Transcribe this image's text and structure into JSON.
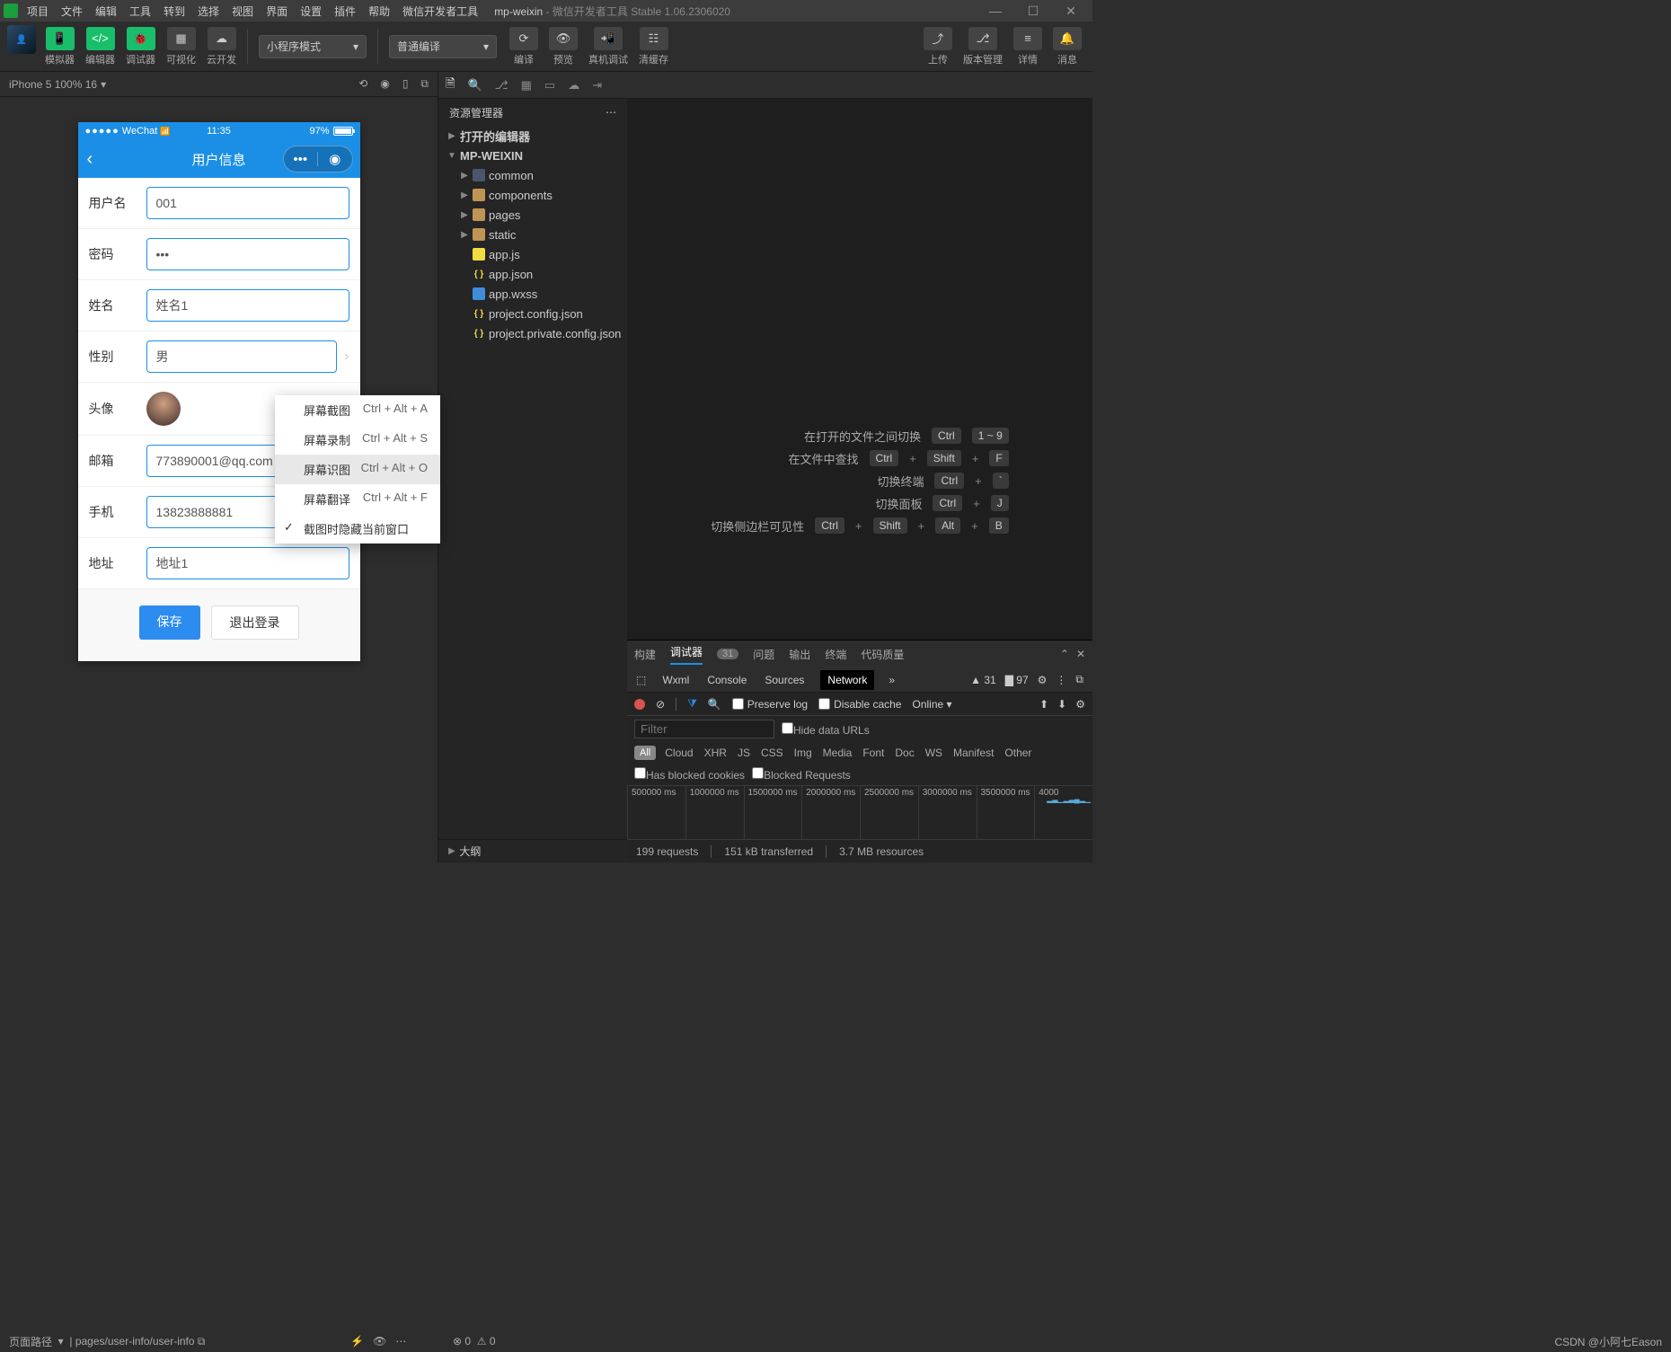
{
  "titlebar": {
    "menus": [
      "项目",
      "文件",
      "编辑",
      "工具",
      "转到",
      "选择",
      "视图",
      "界面",
      "设置",
      "插件",
      "帮助",
      "微信开发者工具"
    ],
    "app": "mp-weixin",
    "subtitle": " - 微信开发者工具 Stable 1.06.2306020"
  },
  "toolbar": {
    "cols": [
      {
        "label": "模拟器"
      },
      {
        "label": "编辑器"
      },
      {
        "label": "调试器"
      },
      {
        "label": "可视化"
      },
      {
        "label": "云开发"
      }
    ],
    "mode": "小程序模式",
    "compile": "普通编译",
    "actions": [
      {
        "label": "编译"
      },
      {
        "label": "预览"
      },
      {
        "label": "真机调试"
      },
      {
        "label": "清缓存"
      }
    ],
    "right": [
      {
        "label": "上传"
      },
      {
        "label": "版本管理"
      },
      {
        "label": "详情"
      },
      {
        "label": "消息"
      }
    ]
  },
  "simheader": {
    "device": "iPhone 5 100% 16"
  },
  "phone": {
    "wechat": "WeChat",
    "time": "11:35",
    "battery": "97%",
    "title": "用户信息",
    "fields": {
      "username": {
        "label": "用户名",
        "value": "001"
      },
      "password": {
        "label": "密码",
        "value": "•••"
      },
      "name": {
        "label": "姓名",
        "value": "姓名1"
      },
      "gender": {
        "label": "性别",
        "value": "男"
      },
      "avatar": {
        "label": "头像"
      },
      "email": {
        "label": "邮箱",
        "value": "773890001@qq.com"
      },
      "phone": {
        "label": "手机",
        "value": "13823888881"
      },
      "address": {
        "label": "地址",
        "value": "地址1"
      }
    },
    "save": "保存",
    "logout": "退出登录"
  },
  "contextmenu": {
    "items": [
      {
        "text": "屏幕截图",
        "key": "Ctrl + Alt + A"
      },
      {
        "text": "屏幕录制",
        "key": "Ctrl + Alt + S"
      },
      {
        "text": "屏幕识图",
        "key": "Ctrl + Alt + O",
        "hover": true
      },
      {
        "text": "屏幕翻译",
        "key": "Ctrl + Alt + F"
      },
      {
        "text": "截图时隐藏当前窗口",
        "checked": true
      }
    ]
  },
  "explorer": {
    "title": "资源管理器",
    "sections": [
      {
        "label": "打开的编辑器",
        "arrow": "▶"
      },
      {
        "label": "MP-WEIXIN",
        "arrow": "▼"
      }
    ],
    "tree": [
      {
        "indent": 1,
        "arrow": "▶",
        "icon": "folder",
        "label": "common"
      },
      {
        "indent": 1,
        "arrow": "▶",
        "icon": "folder-o",
        "label": "components"
      },
      {
        "indent": 1,
        "arrow": "▶",
        "icon": "folder-o",
        "label": "pages"
      },
      {
        "indent": 1,
        "arrow": "▶",
        "icon": "folder-o",
        "label": "static"
      },
      {
        "indent": 1,
        "arrow": "",
        "icon": "js",
        "label": "app.js"
      },
      {
        "indent": 1,
        "arrow": "",
        "icon": "json",
        "label": "app.json"
      },
      {
        "indent": 1,
        "arrow": "",
        "icon": "wxss",
        "label": "app.wxss"
      },
      {
        "indent": 1,
        "arrow": "",
        "icon": "json",
        "label": "project.config.json"
      },
      {
        "indent": 1,
        "arrow": "",
        "icon": "json",
        "label": "project.private.config.json"
      }
    ],
    "outline": "大纲"
  },
  "shortcuts": [
    {
      "text": "在打开的文件之间切换",
      "keys": [
        "Ctrl",
        "1 ~ 9"
      ]
    },
    {
      "text": "在文件中查找",
      "keys": [
        "Ctrl",
        "+",
        "Shift",
        "+",
        "F"
      ]
    },
    {
      "text": "切换终端",
      "keys": [
        "Ctrl",
        "+",
        "`"
      ]
    },
    {
      "text": "切换面板",
      "keys": [
        "Ctrl",
        "+",
        "J"
      ]
    },
    {
      "text": "切换侧边栏可见性",
      "keys": [
        "Ctrl",
        "+",
        "Shift",
        "+",
        "Alt",
        "+",
        "B"
      ]
    }
  ],
  "devtools": {
    "upper": {
      "build": "构建",
      "debugger": "调试器",
      "badge": "31",
      "questions": "问题",
      "output": "输出",
      "terminal": "终端",
      "quality": "代码质量"
    },
    "tabs": [
      "Wxml",
      "Console",
      "Sources",
      "Network"
    ],
    "warn": "31",
    "info": "97",
    "preserve": "Preserve log",
    "disable": "Disable cache",
    "throttle": "Online",
    "filter_ph": "Filter",
    "hide": "Hide data URLs",
    "types": [
      "All",
      "Cloud",
      "XHR",
      "JS",
      "CSS",
      "Img",
      "Media",
      "Font",
      "Doc",
      "WS",
      "Manifest",
      "Other"
    ],
    "blocked_c": "Has blocked cookies",
    "blocked_r": "Blocked Requests",
    "ticks": [
      "500000 ms",
      "1000000 ms",
      "1500000 ms",
      "2000000 ms",
      "2500000 ms",
      "3000000 ms",
      "3500000 ms",
      "4000"
    ],
    "status": {
      "req": "199 requests",
      "tx": "151 kB transferred",
      "res": "3.7 MB resources"
    }
  },
  "bottom": {
    "path_l": "页面路径",
    "path": "pages/user-info/user-info",
    "err": "0",
    "warn": "0",
    "watermark": "CSDN @小阿七Eason"
  }
}
